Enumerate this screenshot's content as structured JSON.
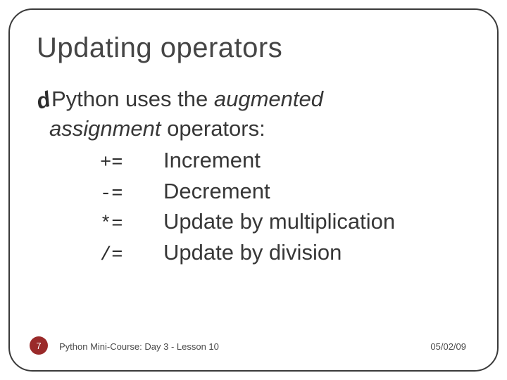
{
  "title": "Updating operators",
  "lead": {
    "prefix": "Python uses the ",
    "italic": "augmented"
  },
  "line2": {
    "italic": "assignment",
    "rest": " operators:"
  },
  "operators": [
    {
      "sym": "+=",
      "desc": "Increment"
    },
    {
      "sym": "-=",
      "desc": "Decrement"
    },
    {
      "sym": "*=",
      "desc": "Update by multiplication"
    },
    {
      "sym": "/=",
      "desc": "Update by division"
    }
  ],
  "footer": {
    "page": "7",
    "course": "Python Mini-Course: Day 3 - Lesson 10",
    "date": "05/02/09"
  },
  "bullet_glyph": "d"
}
